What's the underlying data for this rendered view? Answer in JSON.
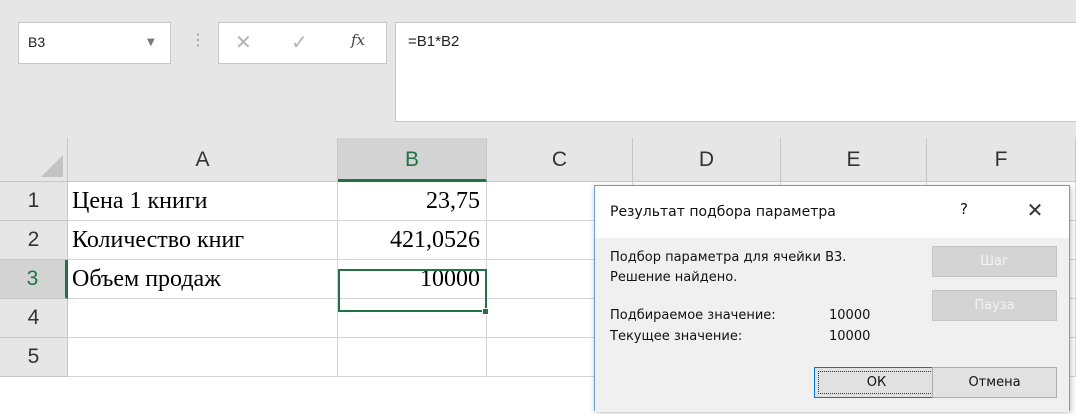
{
  "formula_bar": {
    "name_box": "B3",
    "formula": "=B1*B2",
    "separator": "⋮",
    "cancel_glyph": "✕",
    "enter_glyph": "✓",
    "fx_label": "fx"
  },
  "sheet": {
    "columns": [
      "A",
      "B",
      "C",
      "D",
      "E",
      "F"
    ],
    "rows": [
      "1",
      "2",
      "3",
      "4",
      "5"
    ],
    "selected_cell": "B3",
    "cells": {
      "A1": "Цена 1 книги",
      "B1": "23,75",
      "A2": "Количество книг",
      "B2": "421,0526",
      "A3": "Объем продаж",
      "B3": "10000"
    },
    "accent_color": "#217346"
  },
  "dialog": {
    "title": "Результат подбора параметра",
    "help": "?",
    "message_line1": "Подбор параметра для ячейки B3.",
    "message_line2": "Решение найдено.",
    "target_label": "Подбираемое значение:",
    "target_value": "10000",
    "current_label": "Текущее значение:",
    "current_value": "10000",
    "step_button": "Шаг",
    "pause_button": "Пауза",
    "ok_button": "ОК",
    "cancel_button": "Отмена"
  }
}
